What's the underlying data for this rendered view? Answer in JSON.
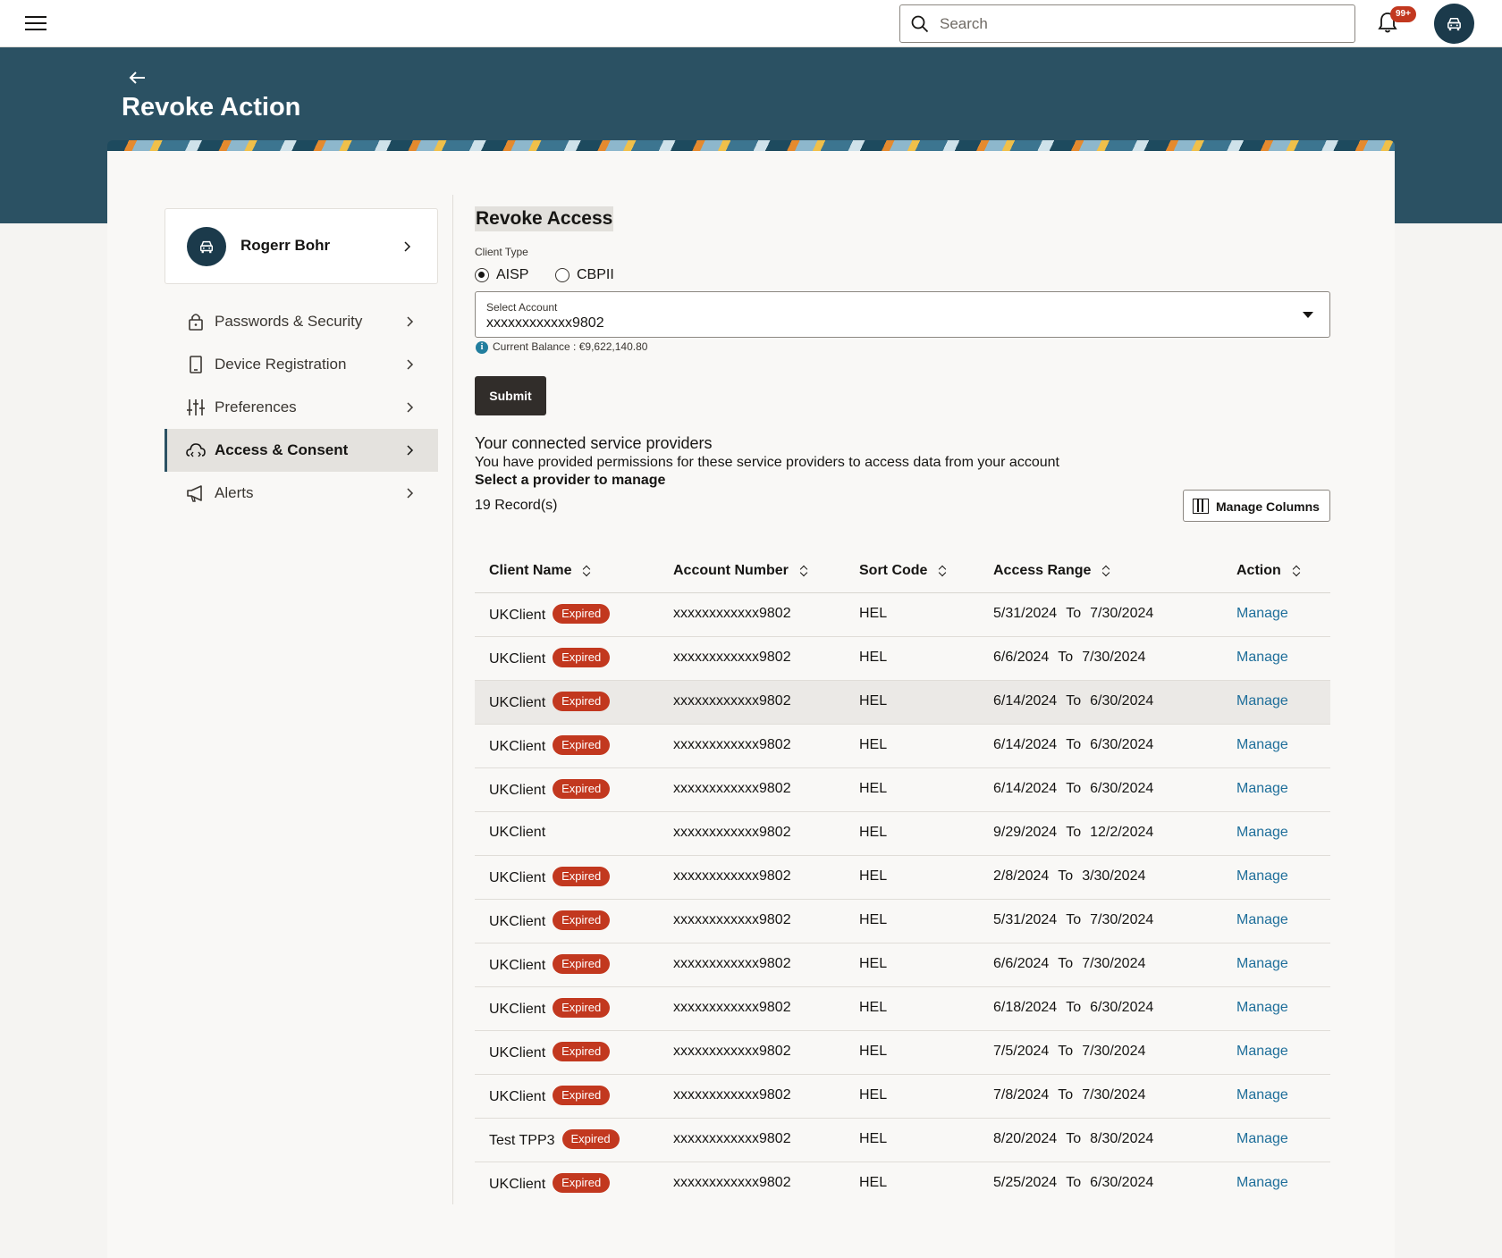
{
  "header": {
    "search_placeholder": "Search",
    "notification_badge": "99+"
  },
  "banner": {
    "title": "Revoke Action"
  },
  "profile": {
    "name": "Rogerr Bohr"
  },
  "menu": [
    {
      "label": "Passwords & Security",
      "icon": "lock-icon"
    },
    {
      "label": "Device Registration",
      "icon": "device-icon"
    },
    {
      "label": "Preferences",
      "icon": "sliders-icon"
    },
    {
      "label": "Access & Consent",
      "icon": "cloud-access-icon",
      "active": true
    },
    {
      "label": "Alerts",
      "icon": "megaphone-icon"
    }
  ],
  "form": {
    "section_title": "Revoke Access",
    "client_type_label": "Client Type",
    "radio_aisp": "AISP",
    "radio_cbpii": "CBPII",
    "selected_client_type": "AISP",
    "select_label": "Select Account",
    "select_value": "xxxxxxxxxxxx9802",
    "balance_text": "Current Balance : €9,622,140.80",
    "submit_label": "Submit"
  },
  "providers": {
    "title": "Your connected service providers",
    "description": "You have provided permissions for these service providers to access data from your account",
    "select_prompt": "Select a provider to manage",
    "records": "19 Record(s)",
    "manage_columns": "Manage Columns"
  },
  "table": {
    "headers": [
      "Client Name",
      "Account Number",
      "Sort Code",
      "Access Range",
      "Action"
    ],
    "to_label": "To",
    "expired_label": "Expired",
    "action_label": "Manage",
    "rows": [
      {
        "client": "UKClient",
        "expired": true,
        "account": "xxxxxxxxxxxx9802",
        "sort": "HEL",
        "from": "5/31/2024",
        "to": "7/30/2024"
      },
      {
        "client": "UKClient",
        "expired": true,
        "account": "xxxxxxxxxxxx9802",
        "sort": "HEL",
        "from": "6/6/2024",
        "to": "7/30/2024"
      },
      {
        "client": "UKClient",
        "expired": true,
        "account": "xxxxxxxxxxxx9802",
        "sort": "HEL",
        "from": "6/14/2024",
        "to": "6/30/2024",
        "highlight": true
      },
      {
        "client": "UKClient",
        "expired": true,
        "account": "xxxxxxxxxxxx9802",
        "sort": "HEL",
        "from": "6/14/2024",
        "to": "6/30/2024"
      },
      {
        "client": "UKClient",
        "expired": true,
        "account": "xxxxxxxxxxxx9802",
        "sort": "HEL",
        "from": "6/14/2024",
        "to": "6/30/2024"
      },
      {
        "client": "UKClient",
        "expired": false,
        "account": "xxxxxxxxxxxx9802",
        "sort": "HEL",
        "from": "9/29/2024",
        "to": "12/2/2024"
      },
      {
        "client": "UKClient",
        "expired": true,
        "account": "xxxxxxxxxxxx9802",
        "sort": "HEL",
        "from": "2/8/2024",
        "to": "3/30/2024"
      },
      {
        "client": "UKClient",
        "expired": true,
        "account": "xxxxxxxxxxxx9802",
        "sort": "HEL",
        "from": "5/31/2024",
        "to": "7/30/2024"
      },
      {
        "client": "UKClient",
        "expired": true,
        "account": "xxxxxxxxxxxx9802",
        "sort": "HEL",
        "from": "6/6/2024",
        "to": "7/30/2024"
      },
      {
        "client": "UKClient",
        "expired": true,
        "account": "xxxxxxxxxxxx9802",
        "sort": "HEL",
        "from": "6/18/2024",
        "to": "6/30/2024"
      },
      {
        "client": "UKClient",
        "expired": true,
        "account": "xxxxxxxxxxxx9802",
        "sort": "HEL",
        "from": "7/5/2024",
        "to": "7/30/2024"
      },
      {
        "client": "UKClient",
        "expired": true,
        "account": "xxxxxxxxxxxx9802",
        "sort": "HEL",
        "from": "7/8/2024",
        "to": "7/30/2024"
      },
      {
        "client": "Test TPP3",
        "expired": true,
        "account": "xxxxxxxxxxxx9802",
        "sort": "HEL",
        "from": "8/20/2024",
        "to": "8/30/2024"
      },
      {
        "client": "UKClient",
        "expired": true,
        "account": "xxxxxxxxxxxx9802",
        "sort": "HEL",
        "from": "5/25/2024",
        "to": "6/30/2024"
      }
    ]
  },
  "colors": {
    "banner": "#2b5163",
    "expired_badge": "#c2381f",
    "link": "#1e6e9a",
    "submit": "#312d2a"
  }
}
